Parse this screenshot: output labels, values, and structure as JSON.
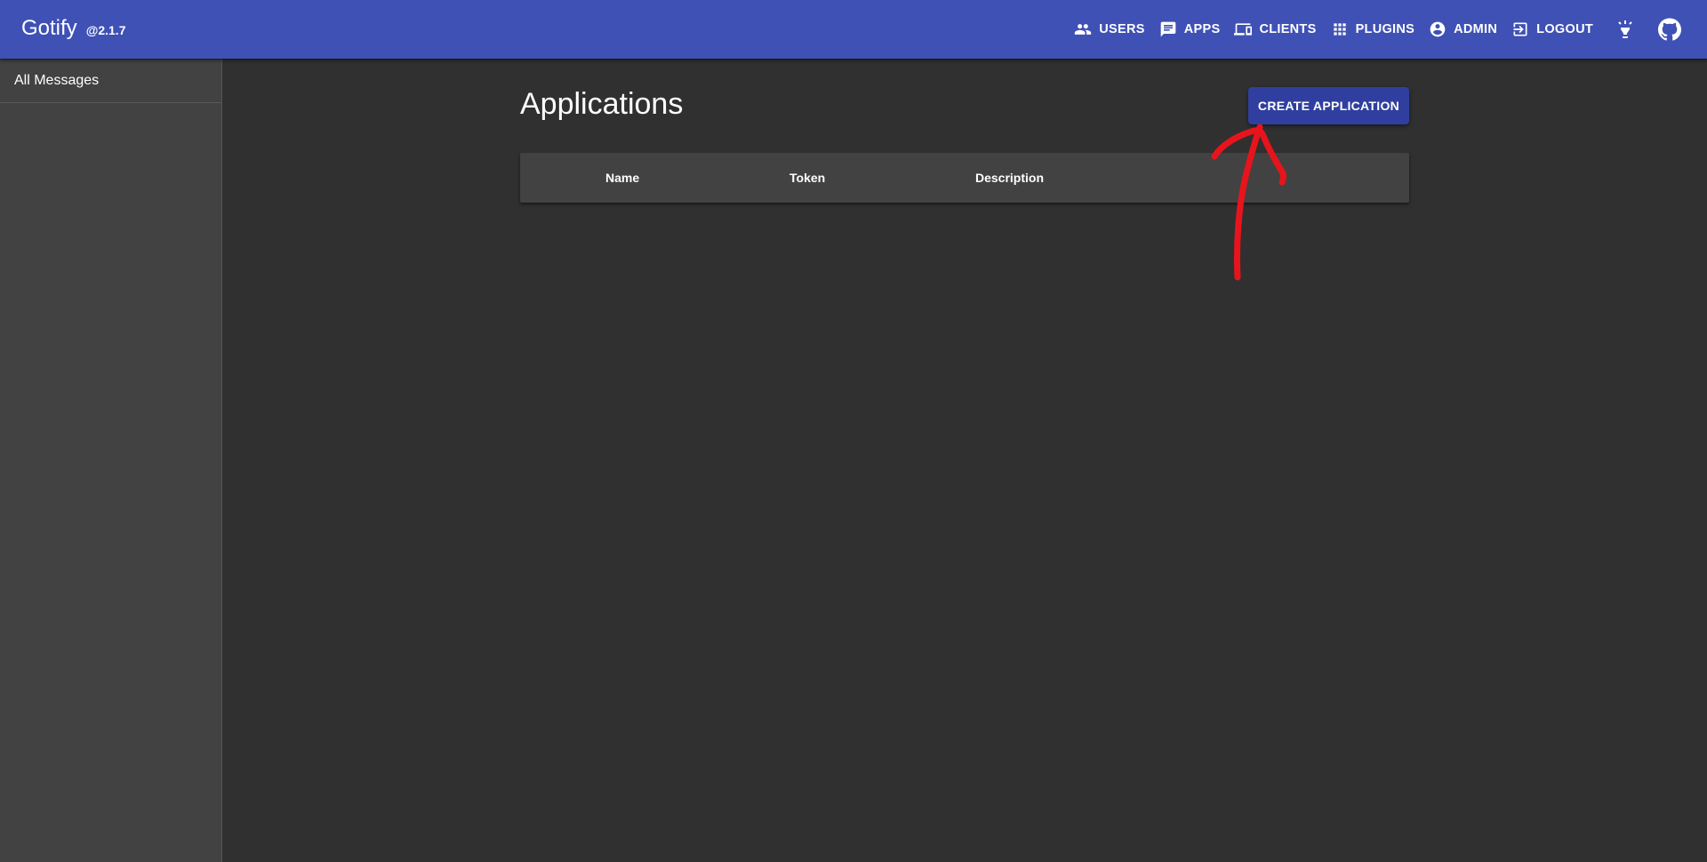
{
  "header": {
    "title": "Gotify",
    "version": "@2.1.7",
    "nav": [
      {
        "label": "USERS",
        "icon": "users-icon"
      },
      {
        "label": "APPS",
        "icon": "chat-icon"
      },
      {
        "label": "CLIENTS",
        "icon": "devices-icon"
      },
      {
        "label": "PLUGINS",
        "icon": "apps-grid-icon"
      },
      {
        "label": "ADMIN",
        "icon": "account-circle-icon"
      },
      {
        "label": "LOGOUT",
        "icon": "exit-icon"
      }
    ],
    "theme_toggle_icon": "lightbulb-icon",
    "github_icon": "github-icon"
  },
  "sidebar": {
    "items": [
      {
        "label": "All Messages"
      }
    ]
  },
  "main": {
    "title": "Applications",
    "create_button": "CREATE APPLICATION",
    "table": {
      "columns": [
        "Name",
        "Token",
        "Description"
      ],
      "rows": []
    }
  },
  "annotation": {
    "type": "red-hand-drawn-arrow",
    "color": "#e8141c",
    "points_to": "create-application-button"
  },
  "colors": {
    "appbar": "#3f51b5",
    "primary_button": "#303f9f",
    "background": "#303030",
    "panel": "#424242"
  }
}
